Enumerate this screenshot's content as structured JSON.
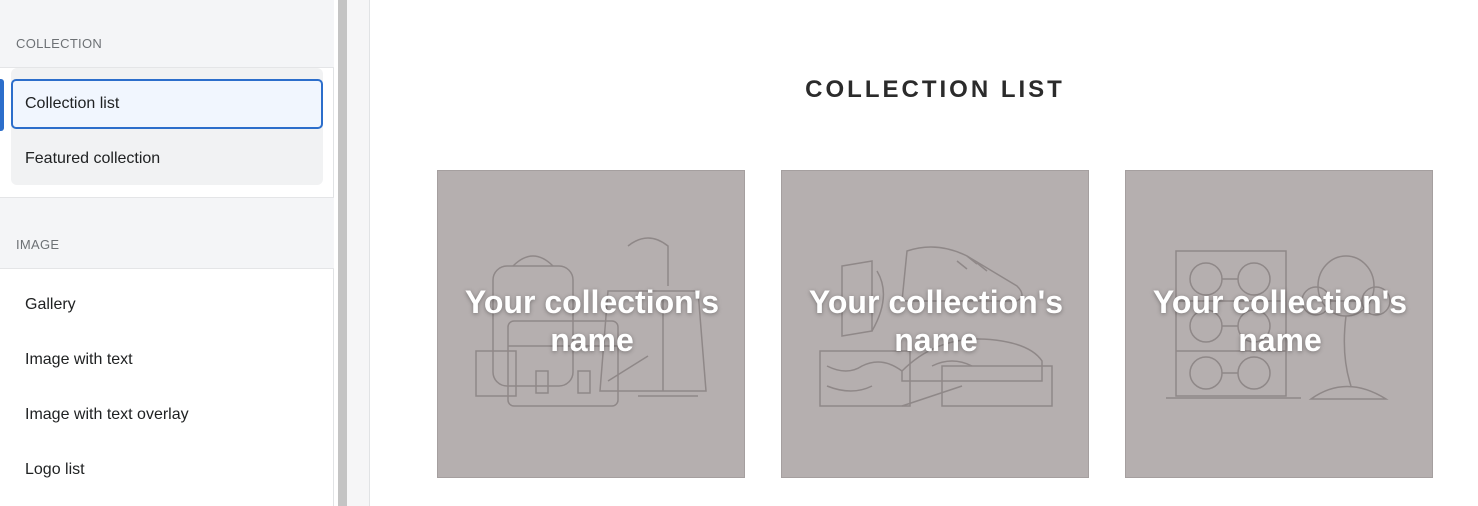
{
  "sidebar": {
    "collection_header": "COLLECTION",
    "collection_items": [
      "Collection list",
      "Featured collection"
    ],
    "image_header": "IMAGE",
    "image_items": [
      "Gallery",
      "Image with text",
      "Image with text overlay",
      "Logo list"
    ]
  },
  "preview": {
    "title": "COLLECTION LIST",
    "cards": [
      {
        "name": "Your collection's name",
        "illustration": "bags-icon"
      },
      {
        "name": "Your collection's name",
        "illustration": "shoes-icon"
      },
      {
        "name": "Your collection's name",
        "illustration": "glasses-icon"
      }
    ]
  },
  "colors": {
    "accent": "#2c6ecb",
    "card_background": "#b5afaf",
    "card_text": "#ffffff"
  }
}
